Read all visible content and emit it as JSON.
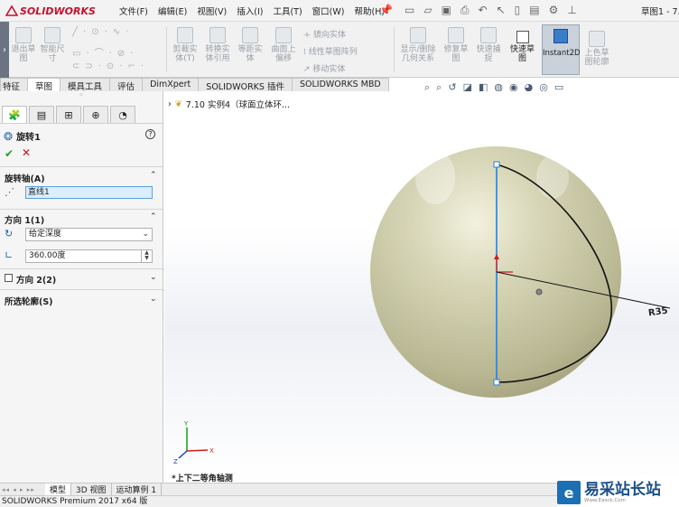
{
  "app": {
    "logo_text": "SOLIDWORKS",
    "doc_title": "草图1 - 7..."
  },
  "menu": [
    "文件(F)",
    "编辑(E)",
    "视图(V)",
    "插入(I)",
    "工具(T)",
    "窗口(W)",
    "帮助(H)"
  ],
  "commands": {
    "exit_sketch": "退出草\n图",
    "smart_dim": "智能尺\n寸",
    "trim": "剪裁实\n体(T)",
    "convert": "转换实\n体引用",
    "offset": "等距实\n体",
    "surface_offset": "曲面上\n偏移",
    "mirror": "镜向实体",
    "linear_pattern": "线性草图阵列",
    "move": "移动实体",
    "display_relations": "显示/删除\n几何关系",
    "repair": "修复草\n图",
    "quick_snaps": "快速捕\n捉",
    "rapid_sketch": "快速草\n图",
    "instant2d": "Instant2D",
    "shaded_sketch": "上色草\n图轮廓"
  },
  "tabs": [
    "特征",
    "草图",
    "模具工具",
    "评估",
    "DimXpert",
    "SOLIDWORKS 插件",
    "SOLIDWORKS MBD"
  ],
  "active_tab": "草图",
  "panel": {
    "feature_name": "旋转1",
    "help": "?",
    "ok": "✔",
    "cancel": "✕",
    "axis_header": "旋转轴(A)",
    "axis_value": "直线1",
    "dir1_header": "方向 1(1)",
    "end_condition": "给定深度",
    "angle_value": "360.00度",
    "dir2_header": "方向 2(2)",
    "contours_header": "所选轮廓(S)"
  },
  "tree": {
    "item": "7.10 实例4（球面立体环..."
  },
  "graphics": {
    "dimension_label": "R35",
    "view_name": "*上下二等角轴测"
  },
  "bottom_tabs": [
    "模型",
    "3D 视图",
    "运动算例 1"
  ],
  "status_text": "SOLIDWORKS Premium 2017 x64 版",
  "watermark": {
    "name": "易采站长站",
    "sub": "Www.Easck.Com"
  },
  "colors": {
    "sphere": "#c9c8a6",
    "axis_line": "#2a7fd4",
    "accent": "#c8102e"
  }
}
